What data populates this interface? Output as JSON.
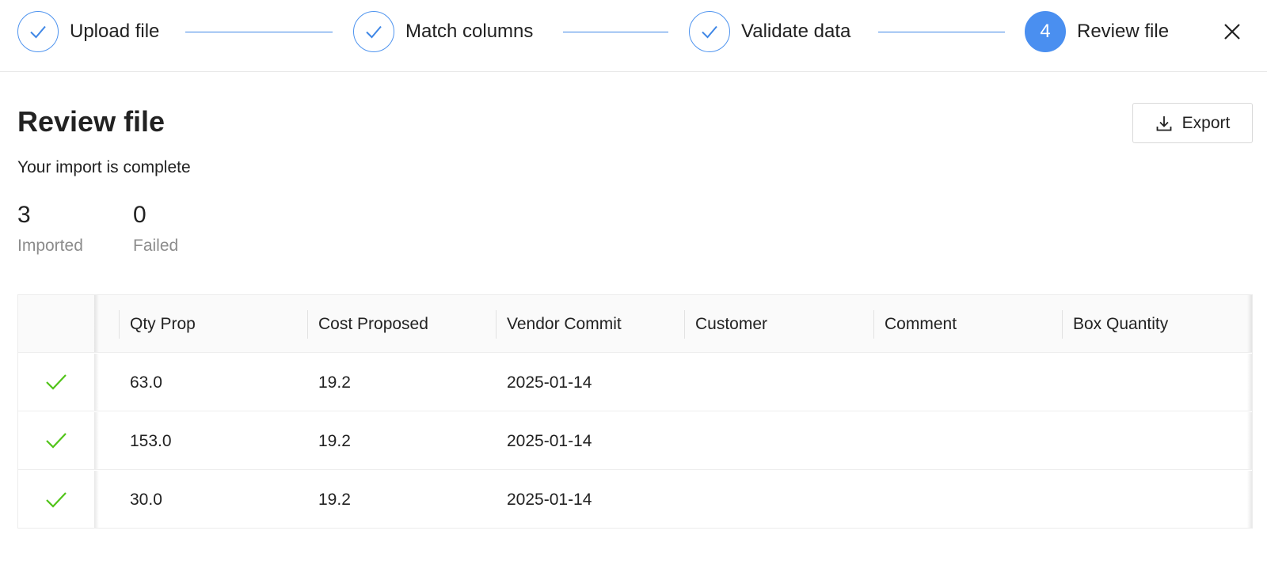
{
  "stepper": {
    "steps": [
      {
        "label": "Upload file",
        "status": "complete"
      },
      {
        "label": "Match columns",
        "status": "complete"
      },
      {
        "label": "Validate data",
        "status": "complete"
      },
      {
        "label": "Review file",
        "status": "active",
        "number": "4"
      }
    ],
    "close_icon": "close-icon",
    "accent_color": "#4a8ff0"
  },
  "header": {
    "title": "Review file",
    "subtitle": "Your import is complete",
    "export_label": "Export",
    "export_icon": "download-icon"
  },
  "stats": [
    {
      "value": "3",
      "label": "Imported"
    },
    {
      "value": "0",
      "label": "Failed"
    }
  ],
  "table": {
    "columns": [
      "Qty Prop",
      "Cost Proposed",
      "Vendor Commit",
      "Customer",
      "Comment",
      "Box Quantity"
    ],
    "rows": [
      {
        "status": "success",
        "cells": [
          "63.0",
          "19.2",
          "2025-01-14",
          "",
          "",
          ""
        ]
      },
      {
        "status": "success",
        "cells": [
          "153.0",
          "19.2",
          "2025-01-14",
          "",
          "",
          ""
        ]
      },
      {
        "status": "success",
        "cells": [
          "30.0",
          "19.2",
          "2025-01-14",
          "",
          "",
          ""
        ]
      }
    ],
    "success_color": "#52c41a"
  }
}
